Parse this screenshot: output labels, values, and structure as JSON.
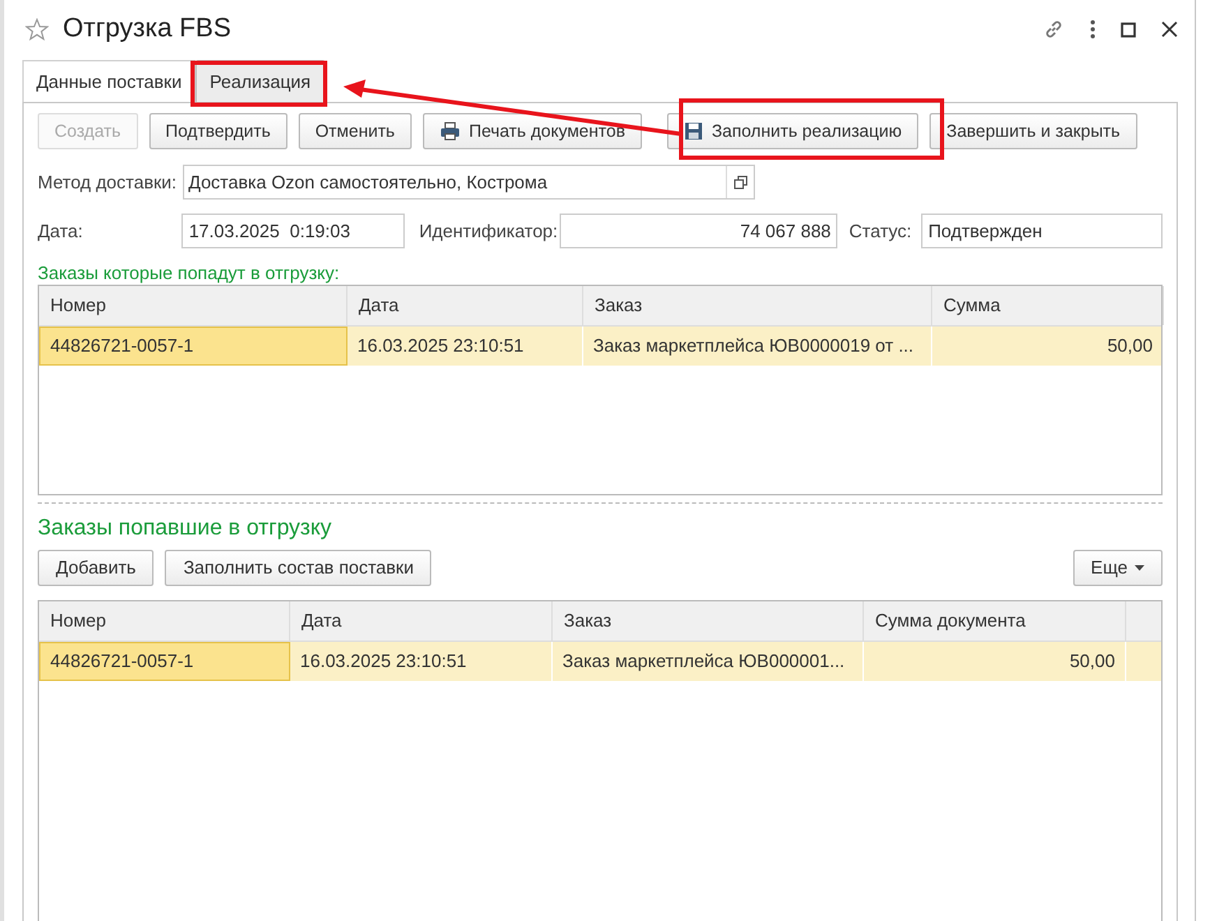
{
  "window": {
    "title": "Отгрузка FBS",
    "favorite": false
  },
  "tabs": [
    {
      "label": "Данные поставки",
      "selected": false
    },
    {
      "label": "Реализация",
      "selected": true
    }
  ],
  "toolbar": [
    {
      "label": "Создать",
      "disabled": true,
      "kind": "plain"
    },
    {
      "label": "Подтвердить",
      "disabled": false,
      "kind": "plain"
    },
    {
      "label": "Отменить",
      "disabled": false,
      "kind": "plain"
    },
    {
      "label": "Печать документов",
      "disabled": false,
      "kind": "print"
    },
    {
      "label": "Заполнить реализацию",
      "disabled": false,
      "kind": "save"
    },
    {
      "label": "Завершить и закрыть",
      "disabled": false,
      "kind": "plain"
    }
  ],
  "delivery_method": {
    "label": "Метод доставки:",
    "value": "Доставка Ozon самостоятельно, Кострома"
  },
  "date": {
    "label": "Дата:",
    "value": "17.03.2025  0:19:03"
  },
  "identifier": {
    "label": "Идентификатор:",
    "value": "74 067 888"
  },
  "status": {
    "label": "Статус:",
    "value": "Подтвержден"
  },
  "orders_to_ship": {
    "title": "Заказы которые попадут в отгрузку:",
    "columns": [
      "Номер",
      "Дата",
      "Заказ",
      "Сумма"
    ],
    "rows": [
      {
        "selected": true,
        "cells": [
          {
            "text": "44826721-0057-1",
            "current": true
          },
          {
            "text": "16.03.2025 23:10:51",
            "current": false
          },
          {
            "text": "Заказ маркетплейса ЮВ0000019 от ...",
            "current": false
          },
          {
            "text": "50,00",
            "current": false
          }
        ]
      }
    ]
  },
  "shipped_orders": {
    "title": "Заказы попавшие в отгрузку",
    "buttons": [
      "Добавить",
      "Заполнить состав поставки"
    ],
    "more": "Еще",
    "columns": [
      "Номер",
      "Дата",
      "Заказ",
      "Сумма документа"
    ],
    "rows": [
      {
        "selected": true,
        "cells": [
          {
            "text": "44826721-0057-1",
            "current": true
          },
          {
            "text": "16.03.2025 23:10:51",
            "current": false
          },
          {
            "text": "Заказ маркетплейса ЮВ000001...",
            "current": false
          },
          {
            "text": "50,00",
            "current": false
          }
        ]
      }
    ]
  }
}
